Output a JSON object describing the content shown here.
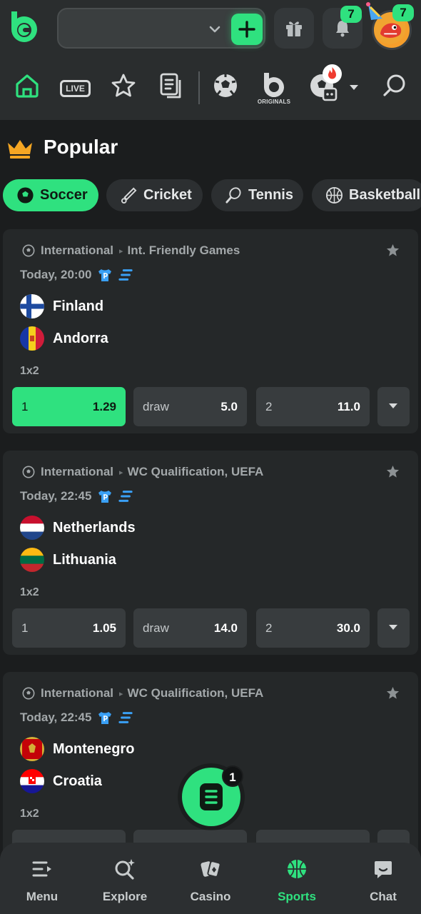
{
  "colors": {
    "accent": "#2fe17f",
    "background": "#1b1d1e",
    "card": "#252829"
  },
  "header": {
    "notifications_count": "7",
    "profile_count": "7"
  },
  "nav": {
    "live_label": "LIVE",
    "originals_label": "ORIGINALS",
    "icons": [
      "home-icon",
      "live-icon",
      "star-icon",
      "betslip-icon",
      "soccer-ball-icon",
      "originals-icon",
      "sports-robot-icon",
      "chevron-down-icon",
      "search-icon"
    ]
  },
  "popular": {
    "title": "Popular",
    "tabs": [
      {
        "label": "Soccer",
        "icon": "soccer-ball-icon",
        "active": true
      },
      {
        "label": "Cricket",
        "icon": "cricket-icon",
        "active": false
      },
      {
        "label": "Tennis",
        "icon": "tennis-icon",
        "active": false
      },
      {
        "label": "Basketball",
        "icon": "basketball-icon",
        "active": false
      }
    ]
  },
  "matches": [
    {
      "category": "International",
      "tournament": "Int. Friendly Games",
      "time": "Today, 20:00",
      "home": "Finland",
      "away": "Andorra",
      "market": "1x2",
      "odds": [
        {
          "label": "1",
          "value": "1.29",
          "selected": true
        },
        {
          "label": "draw",
          "value": "5.0",
          "selected": false
        },
        {
          "label": "2",
          "value": "11.0",
          "selected": false
        }
      ]
    },
    {
      "category": "International",
      "tournament": "WC Qualification, UEFA",
      "time": "Today, 22:45",
      "home": "Netherlands",
      "away": "Lithuania",
      "market": "1x2",
      "odds": [
        {
          "label": "1",
          "value": "1.05",
          "selected": false
        },
        {
          "label": "draw",
          "value": "14.0",
          "selected": false
        },
        {
          "label": "2",
          "value": "30.0",
          "selected": false
        }
      ]
    },
    {
      "category": "International",
      "tournament": "WC Qualification, UEFA",
      "time": "Today, 22:45",
      "home": "Montenegro",
      "away": "Croatia",
      "market": "1x2"
    }
  ],
  "betslip": {
    "count": "1"
  },
  "bottom_nav": [
    {
      "label": "Menu",
      "icon": "menu-icon",
      "active": false
    },
    {
      "label": "Explore",
      "icon": "explore-icon",
      "active": false
    },
    {
      "label": "Casino",
      "icon": "casino-cards-icon",
      "active": false
    },
    {
      "label": "Sports",
      "icon": "basketball-icon",
      "active": true
    },
    {
      "label": "Chat",
      "icon": "chat-icon",
      "active": false
    }
  ]
}
